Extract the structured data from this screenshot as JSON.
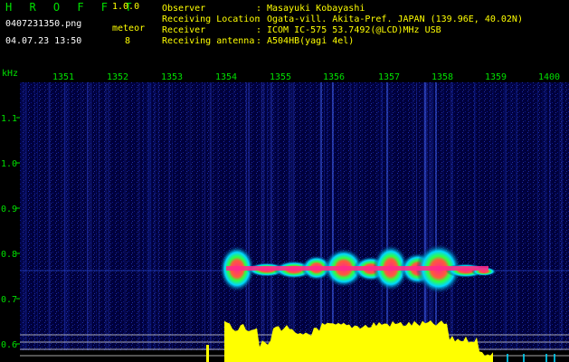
{
  "header": {
    "app_title": "H R O F F T",
    "version": "1.0.0",
    "filename": "0407231350.png",
    "meteor_label": "meteor",
    "datetime": "04.07.23 13:50",
    "meteor_count": "8"
  },
  "info": [
    {
      "key": "Observer",
      "sep": ":",
      "value": "Masayuki Kobayashi"
    },
    {
      "key": "Receiving Location",
      "sep": ":",
      "value": "Ogata-vill. Akita-Pref. JAPAN (139.96E, 40.02N)"
    },
    {
      "key": "Receiver",
      "sep": ":",
      "value": "ICOM IC-575 53.7492(@LCD)MHz USB"
    },
    {
      "key": "Receiving antenna",
      "sep": ":",
      "value": "A504HB(yagi 4el)"
    }
  ],
  "axes": {
    "y_unit": "kHz",
    "y_ticks": [
      "1.1",
      "1.0",
      "0.9",
      "0.8",
      "0.7",
      "0.6"
    ],
    "x_ticks": [
      "1351",
      "1352",
      "1353",
      "1354",
      "1355",
      "1356",
      "1357",
      "1358",
      "1359",
      "1400"
    ]
  },
  "colors": {
    "axis_text": "#00e000",
    "title_text": "#00e000",
    "version_text": "#ffff00",
    "background": "#000000",
    "spectrogram_bg": "#00004a",
    "signal_core": "#ff2a8a",
    "signal_mid": "#00d8ff",
    "amplitude": "#ffff00",
    "level_lines": "#d0d0d0"
  }
}
